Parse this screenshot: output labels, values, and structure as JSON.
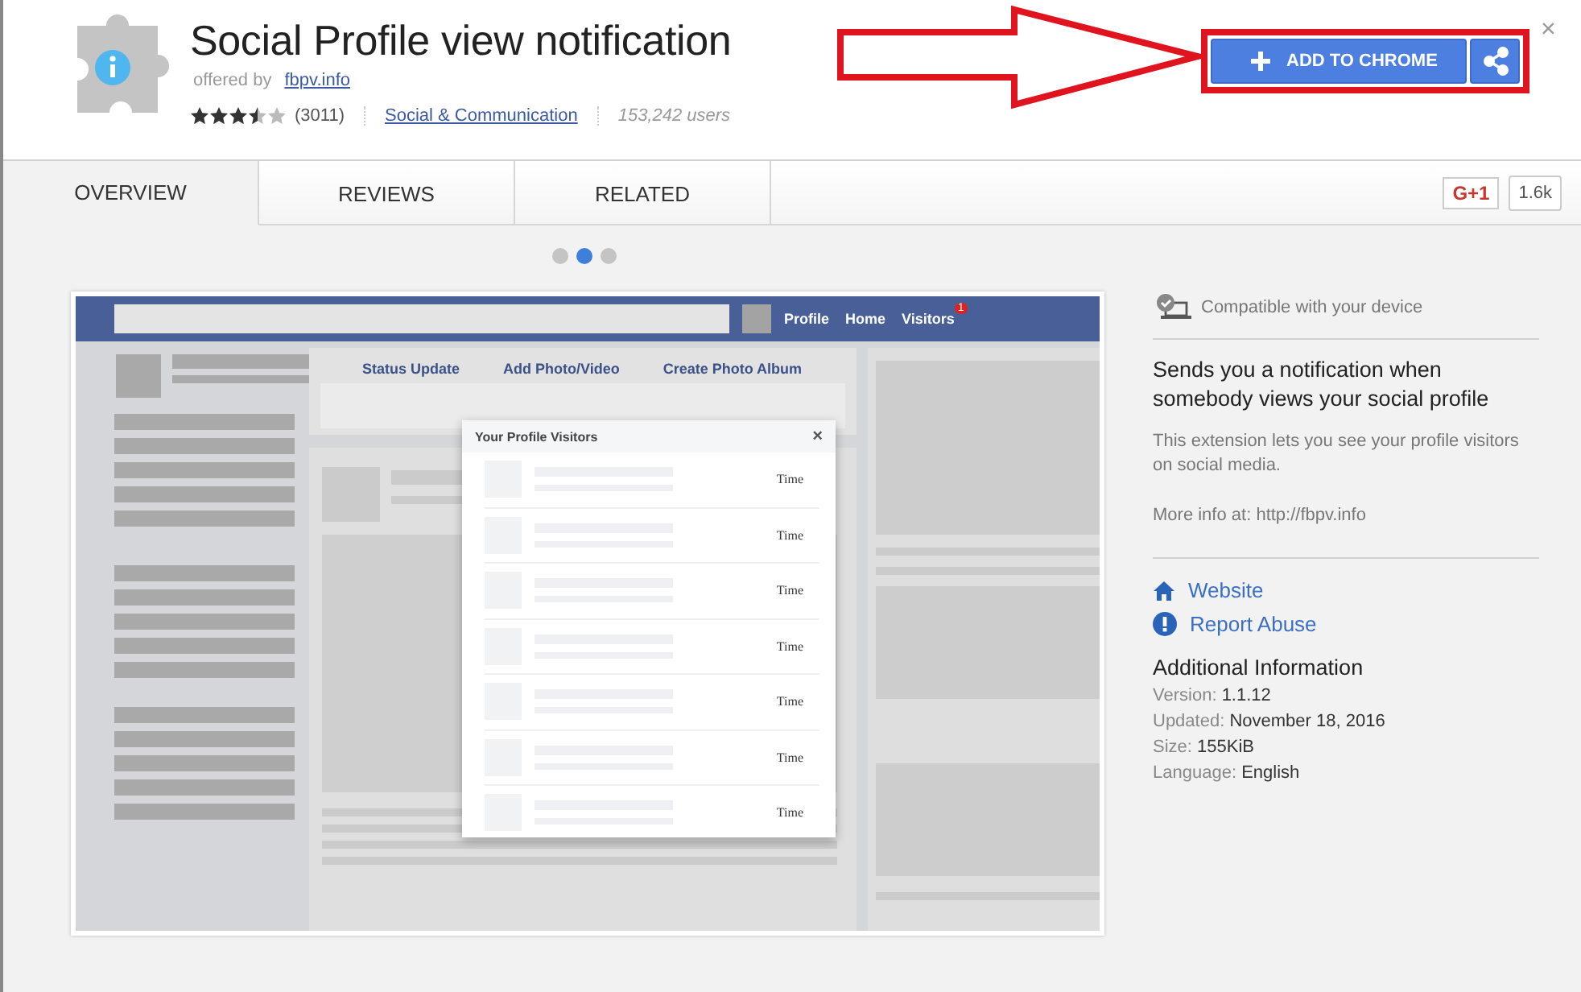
{
  "extension": {
    "title": "Social Profile view notification",
    "offered_label": "offered by",
    "publisher": "fbpv.info",
    "stars": 3.5,
    "rating_count": "(3011)",
    "category": "Social & Communication",
    "users": "153,242 users"
  },
  "add_button": "ADD TO CHROME",
  "close": "×",
  "tabs": [
    {
      "label": "OVERVIEW",
      "selected": true
    },
    {
      "label": "REVIEWS",
      "selected": false
    },
    {
      "label": "RELATED",
      "selected": false
    }
  ],
  "gplus": {
    "label": "G+1",
    "count": "1.6k"
  },
  "carousel": [
    {
      "selected": false
    },
    {
      "selected": true
    },
    {
      "selected": false
    }
  ],
  "screenshot": {
    "nav": [
      "Profile",
      "Home",
      "Visitors"
    ],
    "badge": "1",
    "composer_tabs": [
      "Status Update",
      "Add Photo/Video",
      "Create Photo Album"
    ],
    "popup": {
      "title": "Your Profile Visitors",
      "close": "×",
      "rows": [
        {
          "time": "Time"
        },
        {
          "time": "Time"
        },
        {
          "time": "Time"
        },
        {
          "time": "Time"
        },
        {
          "time": "Time"
        },
        {
          "time": "Time"
        },
        {
          "time": "Time"
        }
      ]
    }
  },
  "sidebar": {
    "compatibility": "Compatible with your device",
    "headline": "Sends you a notification when somebody views your social profile",
    "description": "This extension lets you see your profile visitors on social media.",
    "more_info": "More info at: http://fbpv.info",
    "links": [
      {
        "kind": "website",
        "label": "Website"
      },
      {
        "kind": "report",
        "label": "Report Abuse"
      }
    ],
    "additional_title": "Additional Information",
    "details": [
      "Version: **1.1.12**",
      "Updated: **November 18, 2016**",
      "Size: **155KiB**",
      "Language: **English**"
    ]
  }
}
